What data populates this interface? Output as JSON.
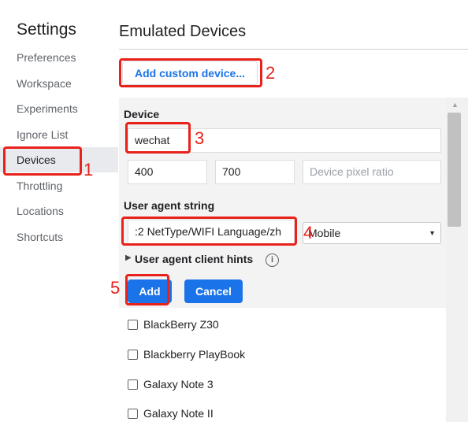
{
  "sidebar": {
    "title": "Settings",
    "items": [
      {
        "label": "Preferences"
      },
      {
        "label": "Workspace"
      },
      {
        "label": "Experiments"
      },
      {
        "label": "Ignore List"
      },
      {
        "label": "Devices",
        "active": true
      },
      {
        "label": "Throttling"
      },
      {
        "label": "Locations"
      },
      {
        "label": "Shortcuts"
      }
    ]
  },
  "main": {
    "title": "Emulated Devices",
    "add_custom_label": "Add custom device...",
    "editor": {
      "device_label": "Device",
      "name_value": "wechat",
      "width_value": "400",
      "height_value": "700",
      "dpr_placeholder": "Device pixel ratio",
      "ua_label": "User agent string",
      "ua_value": ":2 NetType/WIFI Language/zh",
      "ua_type_value": "Mobile",
      "hints_label": "User agent client hints",
      "add_label": "Add",
      "cancel_label": "Cancel"
    },
    "devices": [
      {
        "label": "BlackBerry Z30",
        "checked": false
      },
      {
        "label": "Blackberry PlayBook",
        "checked": false
      },
      {
        "label": "Galaxy Note 3",
        "checked": false
      },
      {
        "label": "Galaxy Note II",
        "checked": false
      }
    ]
  },
  "annotations": [
    "1",
    "2",
    "3",
    "4",
    "5"
  ],
  "colors": {
    "accent": "#1a73e8",
    "annotation": "#e8211a",
    "editor_bg": "#f3f3f3"
  },
  "icons": {
    "info": "info-icon",
    "expand": "triangle-right-icon",
    "dropdown": "caret-down-icon"
  }
}
